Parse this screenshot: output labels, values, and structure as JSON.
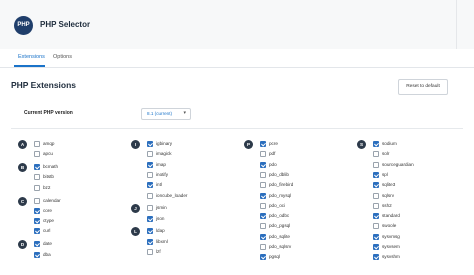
{
  "app": {
    "logo_text": "PHP",
    "title": "PHP Selector"
  },
  "tabs": [
    {
      "label": "Extensions",
      "active": true
    },
    {
      "label": "Options",
      "active": false
    }
  ],
  "section": {
    "title": "PHP Extensions",
    "reset_label": "Reset to default"
  },
  "version": {
    "label": "Current PHP version",
    "selected": "8.1 (current)"
  },
  "colors": {
    "accent": "#1a73c9",
    "checkbox": "#2c6fbe",
    "letter_badge": "#2d3a4a"
  },
  "columns": [
    {
      "groups": [
        {
          "letter": "A",
          "items": [
            {
              "name": "amqp",
              "checked": false
            },
            {
              "name": "apcu",
              "checked": false
            }
          ]
        },
        {
          "letter": "B",
          "items": [
            {
              "name": "bcmath",
              "checked": true
            },
            {
              "name": "bitstb",
              "checked": false
            },
            {
              "name": "bz2",
              "checked": false
            }
          ]
        },
        {
          "letter": "C",
          "items": [
            {
              "name": "calendar",
              "checked": false
            },
            {
              "name": "core",
              "checked": true
            },
            {
              "name": "ctype",
              "checked": true
            },
            {
              "name": "curl",
              "checked": true
            }
          ]
        },
        {
          "letter": "D",
          "items": [
            {
              "name": "date",
              "checked": true
            },
            {
              "name": "dba",
              "checked": true
            }
          ]
        }
      ]
    },
    {
      "groups": [
        {
          "letter": "I",
          "items": [
            {
              "name": "igbinary",
              "checked": true
            },
            {
              "name": "imagick",
              "checked": false
            },
            {
              "name": "imap",
              "checked": true
            },
            {
              "name": "inotify",
              "checked": false
            },
            {
              "name": "intl",
              "checked": true
            },
            {
              "name": "ioncube_loader",
              "checked": false
            }
          ]
        },
        {
          "letter": "J",
          "items": [
            {
              "name": "jsmin",
              "checked": false
            },
            {
              "name": "json",
              "checked": true
            }
          ]
        },
        {
          "letter": "L",
          "items": [
            {
              "name": "ldap",
              "checked": true
            },
            {
              "name": "libxml",
              "checked": true
            },
            {
              "name": "lzf",
              "checked": false
            }
          ]
        }
      ]
    },
    {
      "groups": [
        {
          "letter": "P",
          "items": [
            {
              "name": "pcre",
              "checked": true
            },
            {
              "name": "pdf",
              "checked": false
            },
            {
              "name": "pdo",
              "checked": true
            },
            {
              "name": "pdo_dblib",
              "checked": false
            },
            {
              "name": "pdo_firebird",
              "checked": false
            },
            {
              "name": "pdo_mysql",
              "checked": true
            },
            {
              "name": "pdo_oci",
              "checked": false
            },
            {
              "name": "pdo_odbc",
              "checked": true
            },
            {
              "name": "pdo_pgsql",
              "checked": false
            },
            {
              "name": "pdo_sqlite",
              "checked": true
            },
            {
              "name": "pdo_sqlsrv",
              "checked": false
            },
            {
              "name": "pgsql",
              "checked": true
            }
          ]
        }
      ]
    },
    {
      "groups": [
        {
          "letter": "S",
          "items": [
            {
              "name": "sodium",
              "checked": true
            },
            {
              "name": "solr",
              "checked": false
            },
            {
              "name": "sourceguardian",
              "checked": false
            },
            {
              "name": "spl",
              "checked": true
            },
            {
              "name": "sqlite3",
              "checked": true
            },
            {
              "name": "sqlsrv",
              "checked": false
            },
            {
              "name": "ssh2",
              "checked": false
            },
            {
              "name": "standard",
              "checked": true
            },
            {
              "name": "swoole",
              "checked": false
            },
            {
              "name": "sysvmsg",
              "checked": true
            },
            {
              "name": "sysvsem",
              "checked": true
            },
            {
              "name": "sysvshm",
              "checked": true
            }
          ]
        }
      ]
    }
  ]
}
